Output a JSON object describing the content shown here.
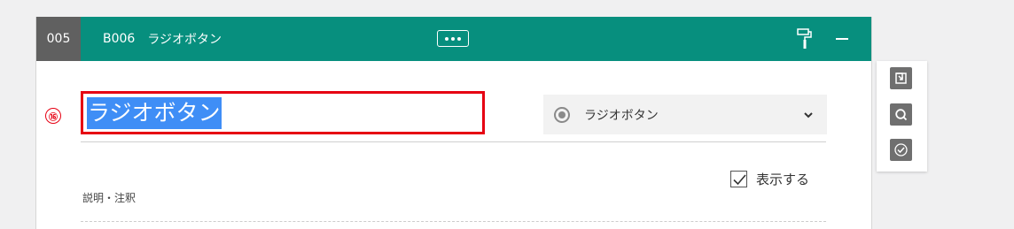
{
  "header": {
    "question_number": "005",
    "question_id": "B006",
    "question_type_title": "ラジオボタン",
    "more_label": "•••",
    "colors": {
      "header_bg": "#078f7e",
      "number_bg": "#606060",
      "highlight": "#e60012",
      "selection": "#3f8ef6"
    },
    "icons": [
      "more-icon",
      "paint-roller-icon",
      "minimize-icon"
    ]
  },
  "question": {
    "number_badge": "⑯",
    "title_value": "ラジオボタン",
    "type_select": {
      "selected": "ラジオボタン",
      "icon": "radio-icon"
    }
  },
  "options": {
    "show_label": "表示する",
    "show_checked": true
  },
  "description": {
    "label": "説明・注釈"
  },
  "side_tools": [
    {
      "name": "insert-icon"
    },
    {
      "name": "search-icon"
    },
    {
      "name": "check-circle-icon"
    }
  ]
}
